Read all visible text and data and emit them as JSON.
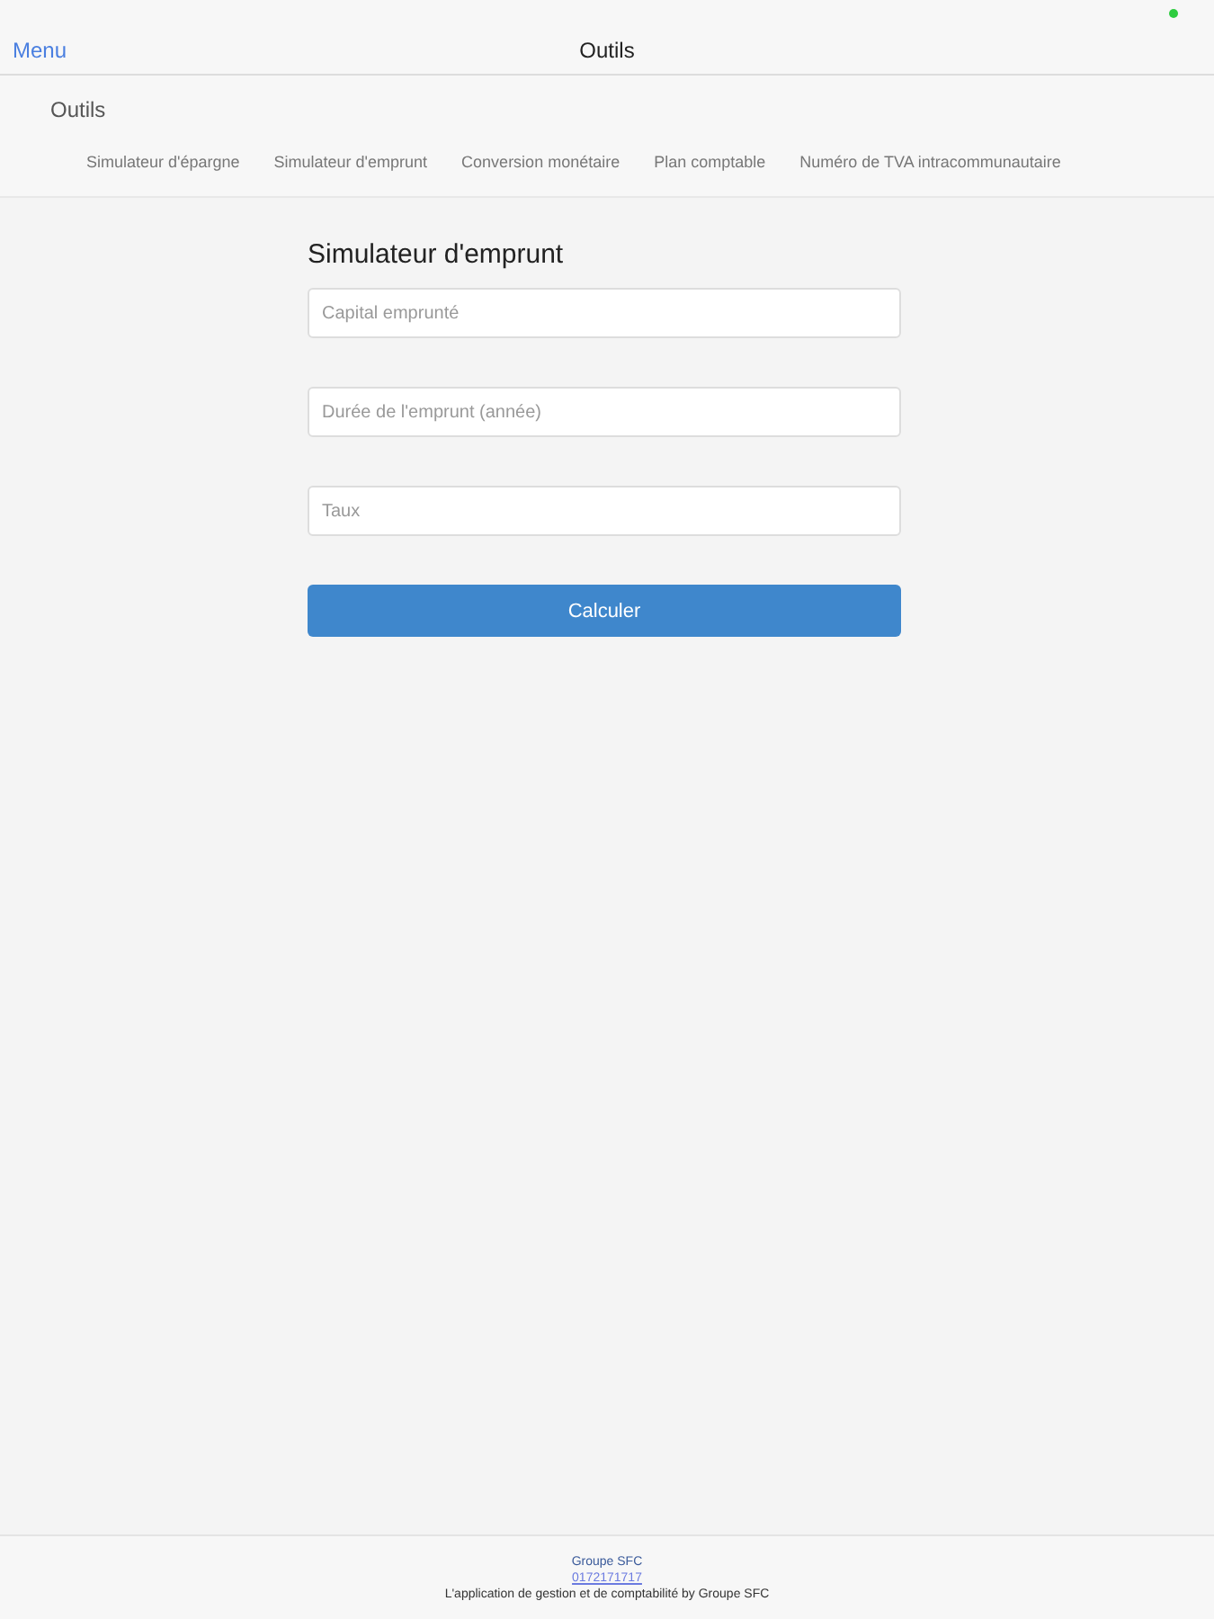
{
  "nav_bar": {
    "menu_link": "Menu",
    "title": "Outils"
  },
  "tools_section": {
    "heading": "Outils",
    "links": [
      "Simulateur d'épargne",
      "Simulateur d'emprunt",
      "Conversion monétaire",
      "Plan comptable",
      "Numéro de TVA intracommunautaire"
    ]
  },
  "form": {
    "title": "Simulateur d'emprunt",
    "fields": [
      {
        "placeholder": "Capital emprunté"
      },
      {
        "placeholder": "Durée de l'emprunt (année)"
      },
      {
        "placeholder": "Taux"
      }
    ],
    "button": "Calculer"
  },
  "footer": {
    "company": "Groupe SFC",
    "phone": "0172171717",
    "tagline": "L'application de gestion et de comptabilité by Groupe SFC"
  }
}
